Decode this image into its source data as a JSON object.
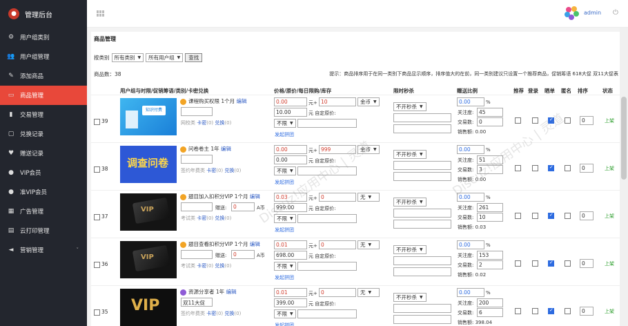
{
  "sidebar": {
    "title": "管理后台",
    "items": [
      {
        "label": "用户组类别",
        "icon": "gear-icon",
        "active": false
      },
      {
        "label": "用户组管理",
        "icon": "users-icon",
        "active": false
      },
      {
        "label": "添加商品",
        "icon": "edit-icon",
        "active": false
      },
      {
        "label": "商品管理",
        "icon": "card-icon",
        "active": true
      },
      {
        "label": "交易管理",
        "icon": "bars-icon",
        "active": false
      },
      {
        "label": "兑换记录",
        "icon": "chat-icon",
        "active": false
      },
      {
        "label": "赠送记录",
        "icon": "heart-icon",
        "active": false
      },
      {
        "label": "VIP会员",
        "icon": "user-icon",
        "active": false
      },
      {
        "label": "准VIP会员",
        "icon": "user-icon",
        "active": false
      },
      {
        "label": "广告管理",
        "icon": "grid-icon",
        "active": false
      },
      {
        "label": "云打印管理",
        "icon": "printer-icon",
        "active": false
      },
      {
        "label": "营销管理",
        "icon": "megaphone-icon",
        "active": false
      }
    ]
  },
  "topbar": {
    "user": "admin"
  },
  "page": {
    "title": "商品管理",
    "filter_label": "按类别",
    "category_select": "所有类别",
    "group_select": "所有用户组",
    "search_btn": "查找",
    "count": "商品数：38",
    "tip": "提示：商品排序用于在同一类别下商品显示顺序，排序值大的在前，同一类别建议只设置一个推荐商品，促销筹语 618大促 双11大促表"
  },
  "headers": {
    "col1": "用户组与时限/促销筹语/类别/卡密兑换",
    "col2": "价格/原价/每日限购/库存",
    "col3": "限时秒杀",
    "col4": "赠送比例",
    "recommend": "推荐",
    "login": "登录",
    "sunny": "晒单",
    "anon": "匿名",
    "sort": "排序",
    "status": "状态"
  },
  "rows": [
    {
      "id": "39",
      "title": "课程购买权限 1个月",
      "edit": "编辑",
      "promo": "",
      "extra": "",
      "currency_val": "",
      "category": "网校类",
      "card": "卡密",
      "card_n": "(0)",
      "redeem": "兑换",
      "redeem_n": "(0)",
      "price": "0.00",
      "plus": "10",
      "currency": "金币",
      "orig": "10.00",
      "custom": "元 自定原价:",
      "limit": "不限",
      "pub": "发起拼团",
      "sec": "不开秒杀",
      "gift": "0.00",
      "pct": "%",
      "attn_l": "关注度:",
      "attn": "45",
      "deal_l": "交易数:",
      "deal": "0",
      "sales_l": "销售额:",
      "sales": "0.00",
      "rec": false,
      "login": false,
      "sunny": true,
      "anon": false,
      "sort": "0",
      "status": "上架",
      "thumb": "a",
      "kind": "gold"
    },
    {
      "id": "38",
      "title": "问卷卷主 1年",
      "edit": "编辑",
      "promo": "",
      "extra": "",
      "currency_val": "",
      "category": "签约年费类",
      "card": "卡密",
      "card_n": "(0)",
      "redeem": "兑换",
      "redeem_n": "(0)",
      "price": "0.00",
      "plus": "999",
      "currency": "金币",
      "orig": "0.00",
      "custom": "元 自定原价:",
      "limit": "不限",
      "pub": "发起拼团",
      "sec": "不开秒杀",
      "gift": "0.00",
      "pct": "%",
      "attn_l": "关注度:",
      "attn": "51",
      "deal_l": "交易数:",
      "deal": "3",
      "sales_l": "销售额:",
      "sales": "0.00",
      "rec": false,
      "login": false,
      "sunny": true,
      "anon": false,
      "sort": "0",
      "status": "上架",
      "thumb": "b",
      "kind": "gold"
    },
    {
      "id": "37",
      "title": "题目加入扣积分VIP 1个月",
      "edit": "编辑",
      "promo": "",
      "extra": "赠送:",
      "currency_val": "0",
      "currency_unit": "A币",
      "category": "考试类",
      "card": "卡密",
      "card_n": "(0)",
      "redeem": "兑换",
      "redeem_n": "(0)",
      "price": "0.03",
      "plus": "0",
      "currency": "无",
      "orig": "999.00",
      "custom": "元 自定原价:",
      "limit": "不限",
      "pub": "发起拼团",
      "sec": "不开秒杀",
      "gift": "0.00",
      "pct": "%",
      "attn_l": "关注度:",
      "attn": "261",
      "deal_l": "交易数:",
      "deal": "10",
      "sales_l": "销售额:",
      "sales": "0.03",
      "rec": false,
      "login": false,
      "sunny": true,
      "anon": false,
      "sort": "0",
      "status": "上架",
      "thumb": "c",
      "kind": "gold"
    },
    {
      "id": "36",
      "title": "题目查看扣积分VIP 1个月",
      "edit": "编辑",
      "promo": "",
      "extra": "赠送:",
      "currency_val": "0",
      "currency_unit": "A币",
      "category": "考试类",
      "card": "卡密",
      "card_n": "(0)",
      "redeem": "兑换",
      "redeem_n": "(0)",
      "price": "0.01",
      "plus": "0",
      "currency": "无",
      "orig": "698.00",
      "custom": "元 自定原价:",
      "limit": "不限",
      "pub": "发起拼团",
      "sec": "不开秒杀",
      "gift": "0.00",
      "pct": "%",
      "attn_l": "关注度:",
      "attn": "153",
      "deal_l": "交易数:",
      "deal": "2",
      "sales_l": "销售额:",
      "sales": "0.02",
      "rec": false,
      "login": false,
      "sunny": true,
      "anon": false,
      "sort": "0",
      "status": "上架",
      "thumb": "c",
      "kind": "gold"
    },
    {
      "id": "35",
      "title": "资源分享者 1年",
      "edit": "编辑",
      "promo": "双11大促",
      "extra": "",
      "currency_val": "",
      "category": "签约年费类",
      "card": "卡密",
      "card_n": "(0)",
      "redeem": "兑换",
      "redeem_n": "(0)",
      "price": "0.01",
      "plus": "0",
      "currency": "无",
      "orig": "399.00",
      "custom": "元 自定原价:",
      "limit": "不限",
      "pub": "发起拼团",
      "sec": "不开秒杀",
      "gift": "0.00",
      "pct": "%",
      "attn_l": "关注度:",
      "attn": "200",
      "deal_l": "交易数:",
      "deal": "6",
      "sales_l": "销售额:",
      "sales": "398.04",
      "rec": false,
      "login": false,
      "sunny": true,
      "anon": false,
      "sort": "0",
      "status": "上架",
      "thumb": "d",
      "kind": "purple"
    }
  ],
  "thumbs": {
    "a": "知识付费",
    "b": "调查问卷",
    "d": "VIP"
  }
}
